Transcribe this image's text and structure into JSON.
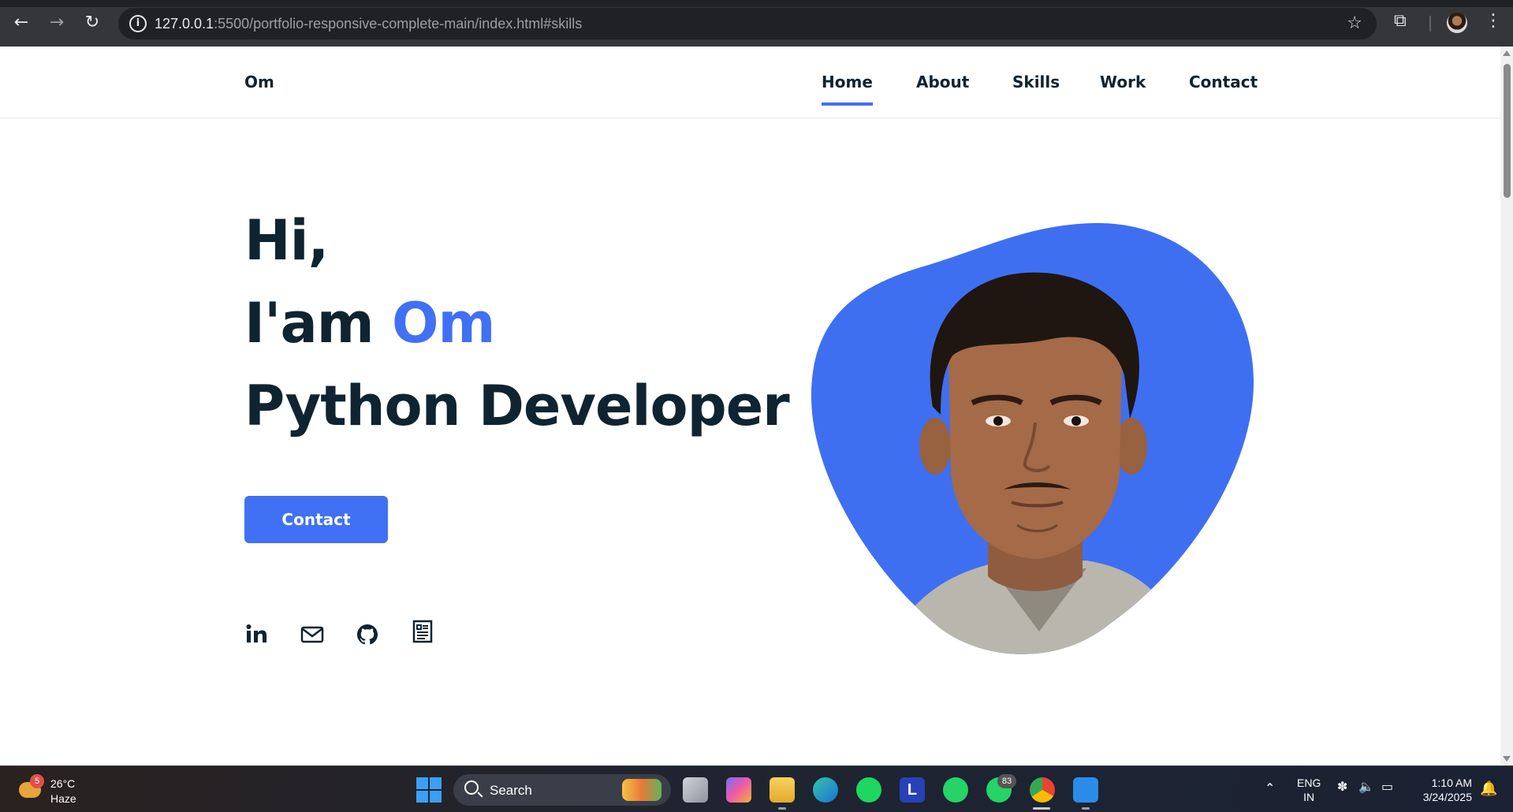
{
  "browser": {
    "url_host": "127.0.0.1",
    "url_rest": ":5500/portfolio-responsive-complete-main/index.html#skills"
  },
  "site": {
    "logo": "Om",
    "nav": [
      {
        "label": "Home",
        "active": true
      },
      {
        "label": "About",
        "active": false
      },
      {
        "label": "Skills",
        "active": false
      },
      {
        "label": "Work",
        "active": false
      },
      {
        "label": "Contact",
        "active": false
      }
    ]
  },
  "hero": {
    "line1": "Hi,",
    "line2_prefix": "I'am ",
    "line2_name": "Om",
    "line3": "Python Developer",
    "contact_button": "Contact",
    "social": [
      "linkedin-icon",
      "mail-icon",
      "github-icon",
      "resume-icon"
    ]
  },
  "colors": {
    "accent": "#4070f4",
    "heading": "#0e2431"
  },
  "taskbar": {
    "weather_badge": "5",
    "temperature": "26°C",
    "condition": "Haze",
    "search_label": "Search",
    "whatsapp_badge": "83",
    "lang_line1": "ENG",
    "lang_line2": "IN",
    "time": "1:10 AM",
    "date": "3/24/2025"
  }
}
